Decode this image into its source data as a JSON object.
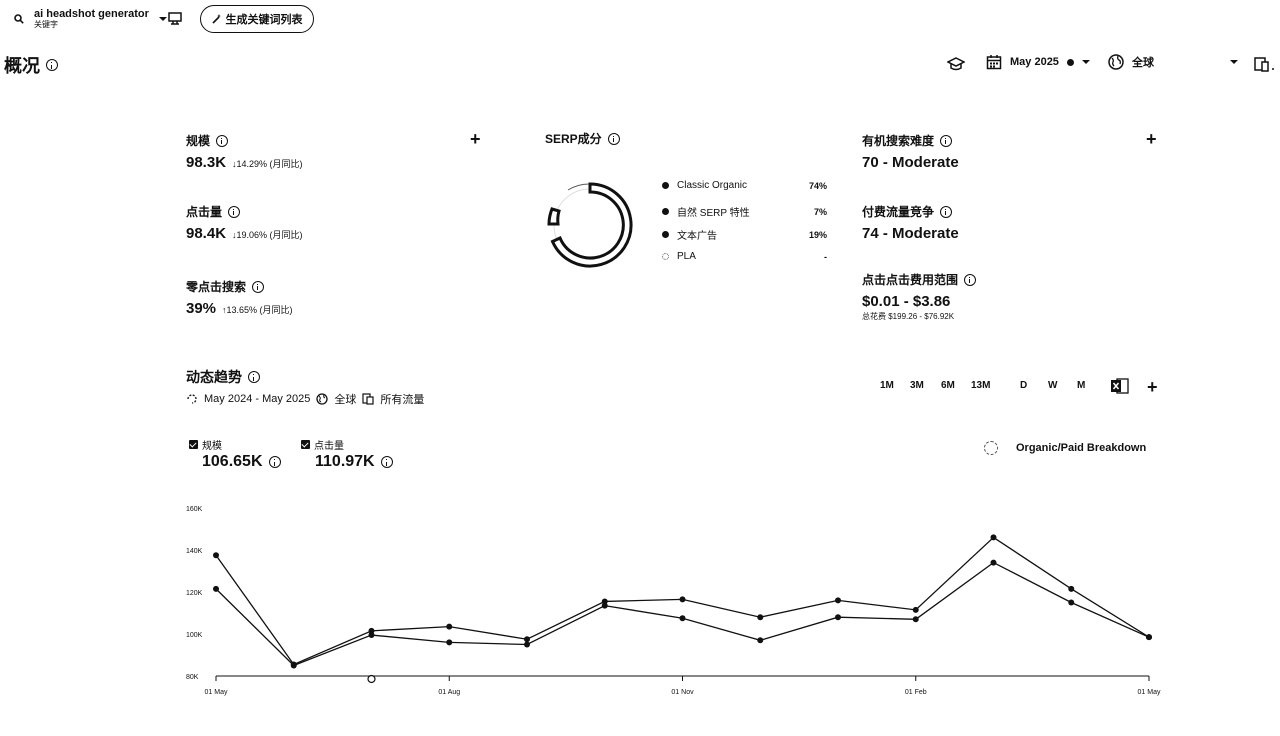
{
  "keyword": {
    "title": "ai headshot generator",
    "subtitle": "关键字"
  },
  "generate_button": "生成关键词列表",
  "page_title": "概况",
  "toolbar": {
    "date": "May 2025",
    "region": "全球"
  },
  "metrics": {
    "volume": {
      "label": "规模",
      "value": "98.3K",
      "delta": "↓14.29% (月同比)"
    },
    "clicks": {
      "label": "点击量",
      "value": "98.4K",
      "delta": "↓19.06% (月同比)"
    },
    "zero_click": {
      "label": "零点击搜索",
      "value": "39%",
      "delta": "↑13.65% (月同比)"
    },
    "organic_kd": {
      "label": "有机搜索难度",
      "value": "70 - Moderate"
    },
    "paid_comp": {
      "label": "付费流量竞争",
      "value": "74 - Moderate"
    },
    "cpc": {
      "label": "点击点击费用范围",
      "value": "$0.01 - $3.86",
      "note": "总花费 $199.26 - $76.92K"
    }
  },
  "serp": {
    "title": "SERP成分",
    "items": [
      {
        "name": "Classic Organic",
        "pct": "74%"
      },
      {
        "name": "自然 SERP 特性",
        "pct": "7%"
      },
      {
        "name": "文本广告",
        "pct": "19%"
      },
      {
        "name": "PLA",
        "pct": "-"
      }
    ]
  },
  "trend": {
    "title": "动态趋势",
    "date_range": "May 2024 - May 2025",
    "region": "全球",
    "traffic": "所有流量",
    "ranges": [
      "1M",
      "3M",
      "6M",
      "13M"
    ],
    "granularity": [
      "D",
      "W",
      "M"
    ],
    "legend": [
      {
        "label": "规模",
        "value": "106.65K"
      },
      {
        "label": "点击量",
        "value": "110.97K"
      }
    ],
    "breakdown_label": "Organic/Paid Breakdown"
  },
  "chart_data": {
    "type": "line",
    "x": [
      "2024-05",
      "2024-06",
      "2024-07",
      "2024-08",
      "2024-09",
      "2024-10",
      "2024-11",
      "2024-12",
      "2025-01",
      "2025-02",
      "2025-03",
      "2025-04",
      "2025-05"
    ],
    "x_tick_labels": [
      "01 May",
      "01 Aug",
      "01 Nov",
      "01 Feb",
      "01 May"
    ],
    "y_tick_labels": [
      "80K",
      "100K",
      "120K",
      "140K",
      "160K"
    ],
    "ylim": [
      80000,
      160000
    ],
    "series": [
      {
        "values": [
          137500,
          85500,
          101500,
          103500,
          97500,
          115500,
          116500,
          108000,
          116000,
          111500,
          146000,
          121500,
          98500
        ]
      },
      {
        "values": [
          121500,
          85000,
          99500,
          96000,
          95000,
          113500,
          107500,
          97000,
          108000,
          107000,
          134000,
          115000,
          98500
        ]
      }
    ]
  }
}
